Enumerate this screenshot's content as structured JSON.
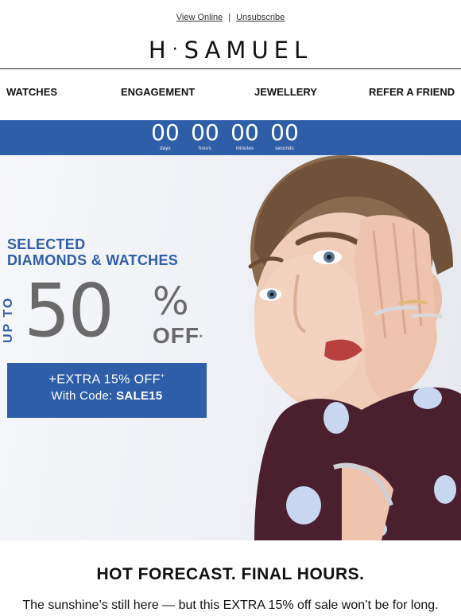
{
  "top_links": {
    "view_online": "View Online",
    "separator": "|",
    "unsubscribe": "Unsubscribe"
  },
  "brand": {
    "logo_left": "H",
    "logo_dot": "·",
    "logo_right": "SAMUEL"
  },
  "nav": {
    "items": [
      "WATCHES",
      "ENGAGEMENT",
      "JEWELLERY",
      "REFER A FRIEND"
    ]
  },
  "countdown": {
    "units": [
      {
        "value": "00",
        "label": "days"
      },
      {
        "value": "00",
        "label": "hours"
      },
      {
        "value": "00",
        "label": "minutes"
      },
      {
        "value": "00",
        "label": "seconds"
      }
    ]
  },
  "hero": {
    "heading_line1": "SELECTED",
    "heading_line2": "DIAMONDS & WATCHES",
    "upto": "UP TO",
    "discount": "50",
    "percent": "%",
    "off": "OFF",
    "off_mark": "*",
    "extra_line": "+EXTRA 15% OFF",
    "extra_mark": "+",
    "code_prefix": "With Code: ",
    "code": "SALE15",
    "image_alt": "model-wearing-rings-and-bracelet"
  },
  "body": {
    "headline": "HOT FORECAST. FINAL HOURS.",
    "subline": "The sunshine’s still here — but this EXTRA 15% off sale won’t be for long."
  },
  "colors": {
    "brand_blue": "#2f5ea8",
    "discount_gray": "#6a6a6a",
    "dress": "#4a1f2e",
    "dots": "#c9d6f0"
  }
}
